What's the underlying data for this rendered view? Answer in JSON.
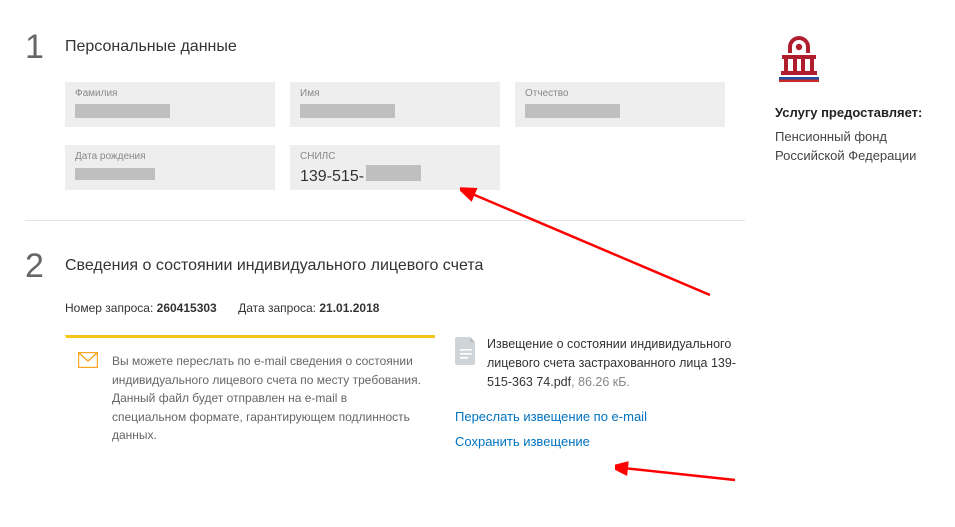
{
  "section1": {
    "number": "1",
    "title": "Персональные данные",
    "fields": {
      "surname_label": "Фамилия",
      "name_label": "Имя",
      "patronymic_label": "Отчество",
      "dob_label": "Дата рождения",
      "snils_label": "СНИЛС",
      "snils_value_prefix": "139-515-"
    }
  },
  "section2": {
    "number": "2",
    "title": "Сведения о состоянии индивидуального лицевого счета",
    "request_number_label": "Номер запроса:",
    "request_number": "260415303",
    "request_date_label": "Дата запроса:",
    "request_date": "21.01.2018",
    "email_info": "Вы можете переслать по e-mail сведения о состоянии индивидуального лицевого счета по месту требования. Данный файл будет отправлен на e-mail в специальном формате, гарантирующем подлинность данных.",
    "file_label_part1": "Извещение о состоянии индивидуального лицевого счета застрахованного лица 139-515-363 74.pdf",
    "file_size": ", 86.26 кБ.",
    "link_send": "Переслать извещение по e-mail",
    "link_save": "Сохранить извещение"
  },
  "sidebar": {
    "heading": "Услугу предоставляет:",
    "provider": "Пенсионный фонд Российской Федерации"
  }
}
